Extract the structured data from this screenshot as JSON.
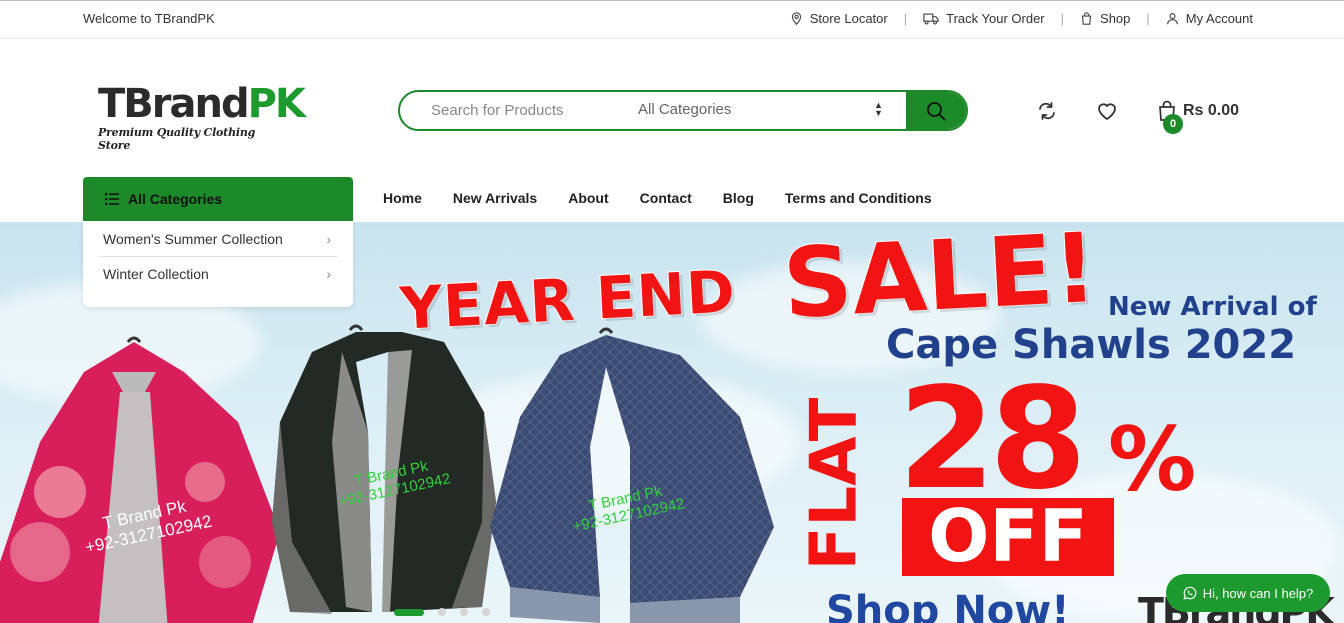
{
  "topbar": {
    "welcome": "Welcome to TBrandPK",
    "links": [
      {
        "label": "Store Locator",
        "icon": "location-pin-icon"
      },
      {
        "label": "Track Your Order",
        "icon": "truck-icon"
      },
      {
        "label": "Shop",
        "icon": "shopping-bag-icon"
      },
      {
        "label": "My Account",
        "icon": "user-icon"
      }
    ]
  },
  "header": {
    "logo_dark": "TBrand",
    "logo_green": "PK",
    "logo_tagline": "Premium Quality Clothing Store",
    "search_placeholder": "Search for Products",
    "category_select": "All Categories",
    "cart_count": "0",
    "cart_total": "Rs 0.00"
  },
  "nav": {
    "all_categories": "All Categories",
    "items": [
      "Home",
      "New Arrivals",
      "About",
      "Contact",
      "Blog",
      "Terms and Conditions"
    ]
  },
  "category_menu": [
    "Women's Summer Collection",
    "Winter Collection"
  ],
  "hero": {
    "year_end": "YEAR END",
    "sale": "SALE!",
    "new_arrival": "New Arrival of",
    "cape": "Cape Shawls 2022",
    "flat": "FLAT",
    "percent_num": "28",
    "percent_sign": "%",
    "off": "OFF",
    "shop_now": "Shop Now!",
    "logo_partial": "TBrandPK",
    "watermark_name": "T Brand Pk",
    "watermark_phone": "+92-3127102942",
    "slides": 4,
    "active_slide": 1
  },
  "chat": {
    "label": "Hi, how can I help?"
  },
  "colors": {
    "brand_green": "#1d8a2a",
    "sale_red": "#f21313",
    "headline_blue": "#22418d"
  }
}
